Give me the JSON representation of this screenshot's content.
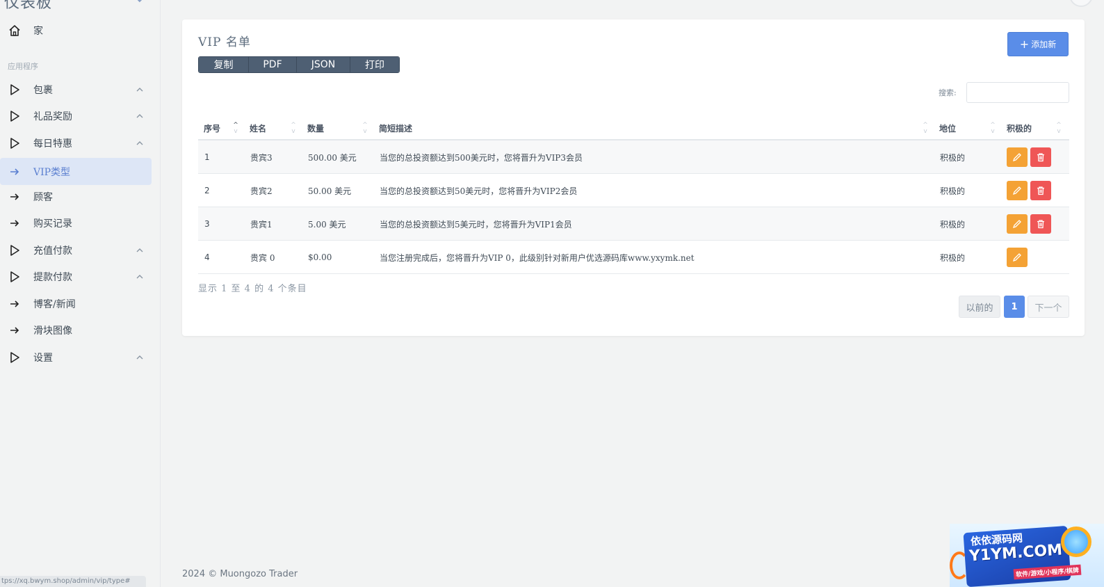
{
  "sidebar": {
    "brand": "仪表板",
    "section_label": "应用程序",
    "items": [
      {
        "label": "家",
        "icon": "home-icon",
        "type": "home"
      },
      {
        "label": "包裹",
        "icon": "play-icon",
        "type": "group"
      },
      {
        "label": "礼品奖励",
        "icon": "play-icon",
        "type": "group"
      },
      {
        "label": "每日特惠",
        "icon": "play-icon",
        "type": "group"
      },
      {
        "label": "VIP类型",
        "icon": "arrow-right-icon",
        "type": "link",
        "active": true
      },
      {
        "label": "顾客",
        "icon": "arrow-right-icon",
        "type": "link"
      },
      {
        "label": "购买记录",
        "icon": "arrow-right-icon",
        "type": "link"
      },
      {
        "label": "充值付款",
        "icon": "play-icon",
        "type": "group"
      },
      {
        "label": "提款付款",
        "icon": "play-icon",
        "type": "group"
      },
      {
        "label": "博客/新闻",
        "icon": "arrow-right-icon",
        "type": "link"
      },
      {
        "label": "滑块图像",
        "icon": "arrow-right-icon",
        "type": "link"
      },
      {
        "label": "设置",
        "icon": "play-icon",
        "type": "group"
      }
    ],
    "status_url": "tps://xq.bwym.shop/admin/vip/type#"
  },
  "card": {
    "title": "VIP 名单",
    "add_button": "添加新",
    "export_buttons": [
      "复制",
      "PDF",
      "JSON",
      "打印"
    ],
    "search_label": "搜索:",
    "search_value": "",
    "columns": [
      "序号",
      "姓名",
      "数量",
      "简短描述",
      "地位",
      "积极的"
    ],
    "rows": [
      {
        "no": "1",
        "name": "贵宾3",
        "amount": "500.00 美元",
        "desc": "当您的总投资额达到500美元时，您将晋升为VIP3会员",
        "status": "积极的",
        "deletable": true
      },
      {
        "no": "2",
        "name": "贵宾2",
        "amount": "50.00 美元",
        "desc": "当您的总投资额达到50美元时，您将晋升为VIP2会员",
        "status": "积极的",
        "deletable": true
      },
      {
        "no": "3",
        "name": "贵宾1",
        "amount": "5.00 美元",
        "desc": "当您的总投资额达到5美元时，您将晋升为VIP1会员",
        "status": "积极的",
        "deletable": true
      },
      {
        "no": "4",
        "name": "贵宾 0",
        "amount": "$0.00",
        "desc": "当您注册完成后，您将晋升为VIP 0，此级别针对新用户优选源码库www.yxymk.net",
        "status": "积极的",
        "deletable": false
      }
    ],
    "info": "显示 1 至 4 的 4 个条目",
    "pager": {
      "prev": "以前的",
      "current": "1",
      "next": "下一个"
    }
  },
  "footer": "2024 © Muongozo Trader",
  "watermark": {
    "line1": "依依源码网",
    "line2": "Y1YM.COM",
    "line3": "软件/游戏/小程序/棋牌"
  },
  "colors": {
    "accent": "#5a8de8",
    "edit": "#f4a235",
    "delete": "#ef5656",
    "btn_group": "#4e5f73"
  }
}
